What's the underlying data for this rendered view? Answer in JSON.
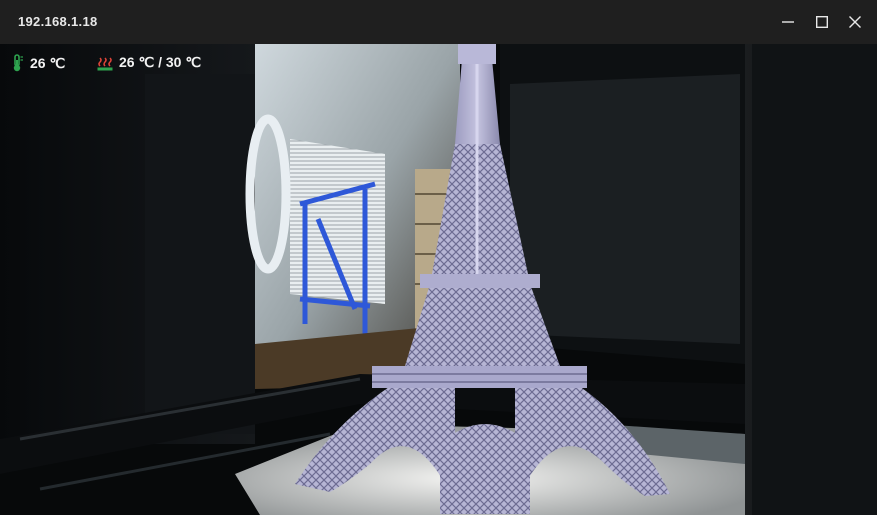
{
  "window": {
    "title": "192.168.1.18",
    "controls": {
      "minimize_icon": "minimize-icon",
      "maximize_icon": "maximize-icon",
      "close_icon": "close-icon"
    }
  },
  "overlay": {
    "nozzle_temp": "26 ℃",
    "nozzle_icon": "thermometer-icon",
    "bed_temp": "26 ℃ / 30 ℃",
    "bed_icon": "heated-bed-icon",
    "icon_colors": {
      "nozzle": "#2ea44f",
      "bed_base": "#2ea44f",
      "bed_heat": "#e0453a"
    }
  },
  "feed": {
    "subject": "camera-feed-image"
  }
}
